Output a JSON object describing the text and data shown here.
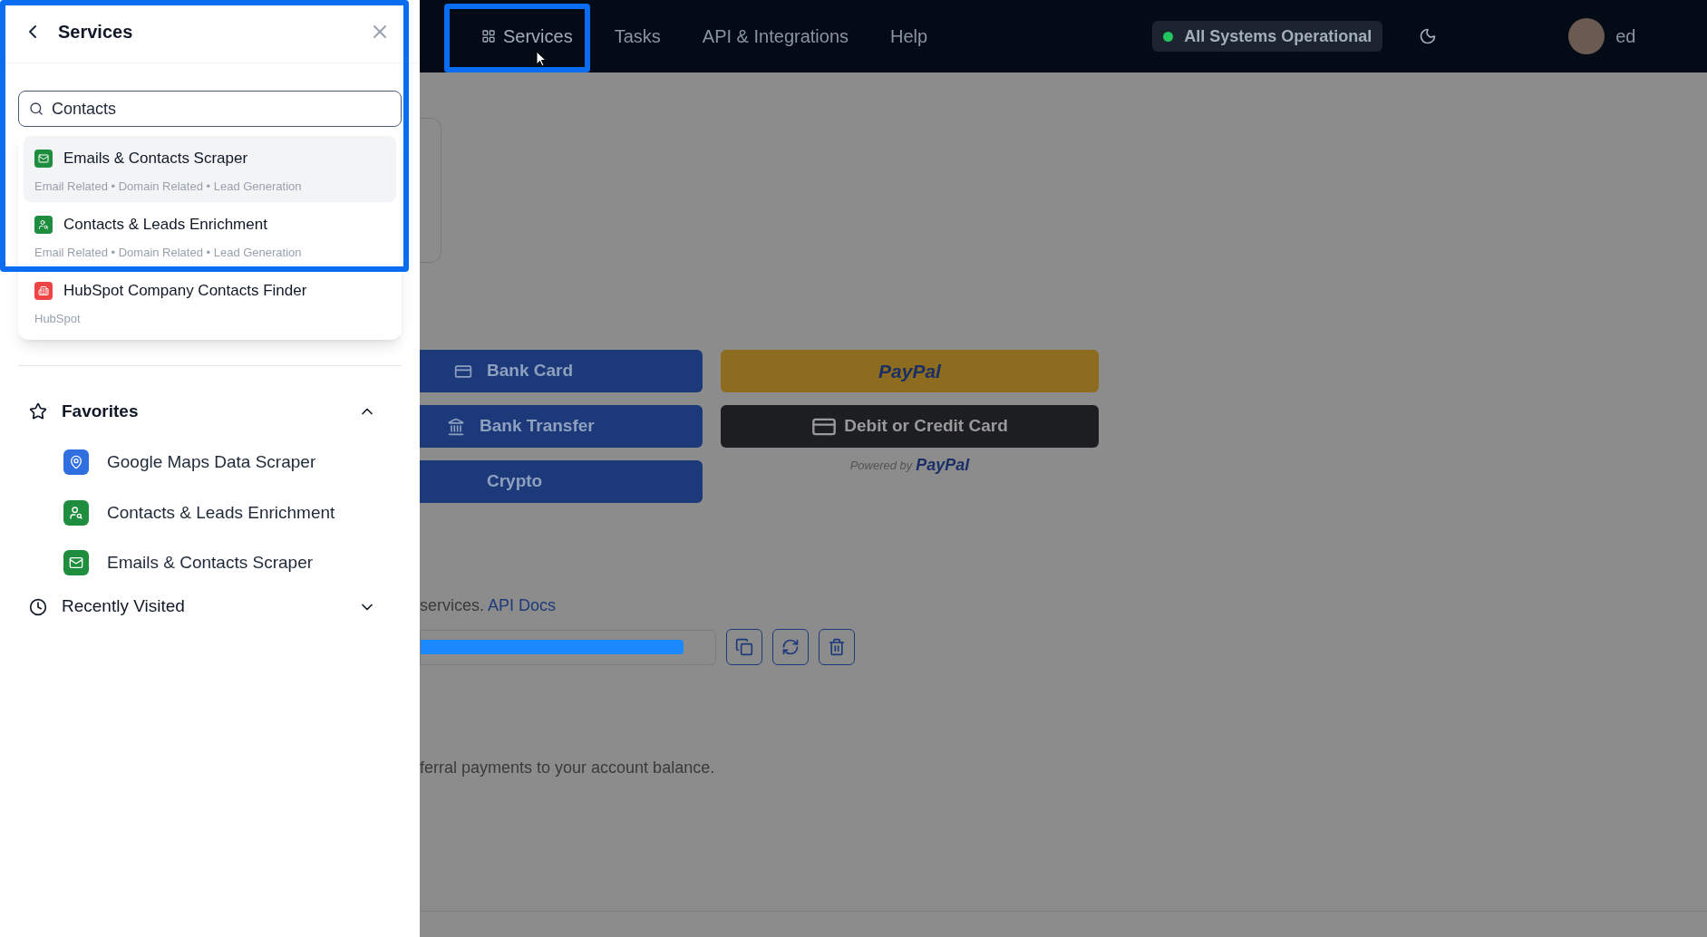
{
  "header": {
    "nav": [
      {
        "label": "Services",
        "selected": true,
        "kind": "grid"
      },
      {
        "label": "Tasks",
        "selected": false
      },
      {
        "label": "API & Integrations",
        "selected": false
      },
      {
        "label": "Help",
        "selected": false
      }
    ],
    "status": {
      "text": "All Systems Operational",
      "color": "#22c55e"
    },
    "user": {
      "name": "ed"
    }
  },
  "sidebar": {
    "title": "Services",
    "search": {
      "value": "Contacts"
    },
    "results": [
      {
        "name": "Emails & Contacts Scraper",
        "tags": "Email Related • Domain Related • Lead Generation",
        "color": "#1e8e3e",
        "selected": true
      },
      {
        "name": "Contacts & Leads Enrichment",
        "tags": "Email Related • Domain Related • Lead Generation",
        "color": "#1e8e3e",
        "selected": false
      },
      {
        "name": "HubSpot Company Contacts Finder",
        "tags": "HubSpot",
        "color": "#ef4444",
        "selected": false
      }
    ],
    "sections": [
      {
        "title": "Favorites",
        "kind": "star",
        "expanded": true,
        "items": [
          {
            "name": "Google Maps Data Scraper",
            "color": "#2f6fe0"
          },
          {
            "name": "Contacts & Leads Enrichment",
            "color": "#1e8e3e"
          },
          {
            "name": "Emails & Contacts Scraper",
            "color": "#1e8e3e"
          }
        ]
      },
      {
        "title": "Recently Visited",
        "kind": "clock",
        "expanded": false
      }
    ]
  },
  "main": {
    "methods": [
      {
        "label": "Bank Card",
        "kind": "card"
      },
      {
        "label": "Bank Transfer",
        "kind": "bank"
      },
      {
        "label": "Crypto",
        "kind": "none"
      }
    ],
    "paypal": {
      "button": "PayPal",
      "card": "Debit or Credit Card",
      "powered": "Powered by",
      "brand": "PayPal"
    },
    "api": {
      "text": "services.",
      "link": "API Docs"
    },
    "referral": "ferral payments to your account balance."
  }
}
